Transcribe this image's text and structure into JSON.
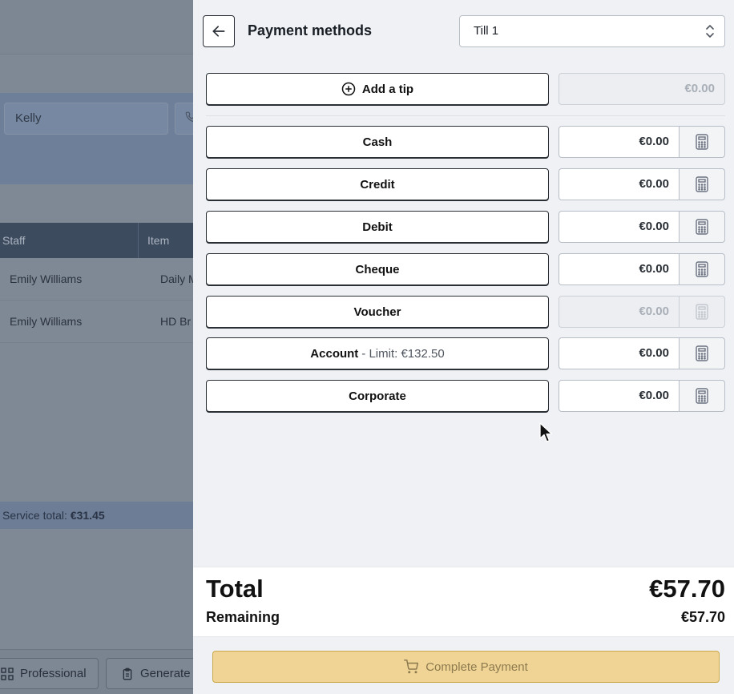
{
  "background": {
    "customer_name": "Kelly",
    "table_headers": [
      "Staff",
      "Item"
    ],
    "rows": [
      {
        "staff": "Emily Williams",
        "item": "Daily M"
      },
      {
        "staff": "Emily Williams",
        "item": "HD Br"
      }
    ],
    "service_total_label": "Service total:",
    "service_total_value": "€31.45",
    "bottom_buttons": [
      "Professional",
      "Generate"
    ]
  },
  "panel": {
    "title": "Payment methods",
    "till": {
      "selected": "Till 1"
    },
    "tip": {
      "label": "Add a tip",
      "amount": "€0.00"
    },
    "methods": [
      {
        "label": "Cash",
        "amount": "€0.00",
        "enabled": true
      },
      {
        "label": "Credit",
        "amount": "€0.00",
        "enabled": true
      },
      {
        "label": "Debit",
        "amount": "€0.00",
        "enabled": true
      },
      {
        "label": "Cheque",
        "amount": "€0.00",
        "enabled": true
      },
      {
        "label": "Voucher",
        "amount": "€0.00",
        "enabled": false
      },
      {
        "label": "Account",
        "limit_text": "- Limit: €132.50",
        "amount": "€0.00",
        "enabled": true
      },
      {
        "label": "Corporate",
        "amount": "€0.00",
        "enabled": true
      }
    ],
    "total_label": "Total",
    "total_value": "€57.70",
    "remaining_label": "Remaining",
    "remaining_value": "€57.70",
    "complete_button": "Complete Payment"
  },
  "colors": {
    "complete_button_bg": "#efd495",
    "panel_bg": "#eff1f4",
    "overlay_bg": "#7f8895"
  }
}
